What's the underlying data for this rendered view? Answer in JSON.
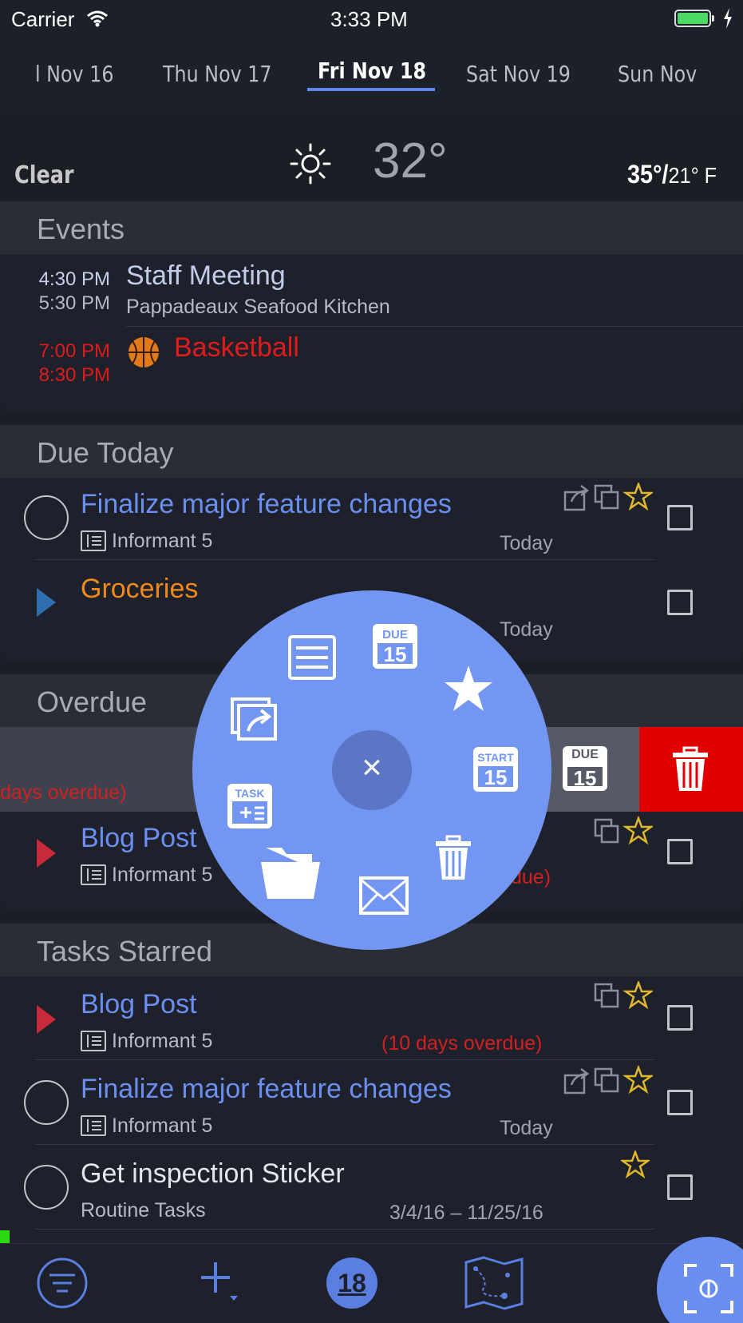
{
  "status_bar": {
    "carrier": "Carrier",
    "time": "3:33 PM"
  },
  "days": [
    {
      "label": "l  Nov 16",
      "selected": false
    },
    {
      "label": "Thu  Nov 17",
      "selected": false
    },
    {
      "label": "Fri  Nov 18",
      "selected": true
    },
    {
      "label": "Sat  Nov 19",
      "selected": false
    },
    {
      "label": "Sun  Nov",
      "selected": false
    }
  ],
  "weather": {
    "condition": "Clear",
    "temp": "32°",
    "high": "35°/",
    "low": "21° F",
    "icon": "sun-icon"
  },
  "events": {
    "header": "Events",
    "items": [
      {
        "start": "4:30 PM",
        "end": "5:30 PM",
        "title": "Staff Meeting",
        "location": "Pappadeaux Seafood Kitchen",
        "color": "#c2cbe8"
      },
      {
        "start": "7:00 PM",
        "end": "8:30 PM",
        "title": "Basketball",
        "location": "",
        "color": "#e01b1b",
        "icon": "basketball-icon"
      }
    ]
  },
  "due_today": {
    "header": "Due Today",
    "items": [
      {
        "title": "Finalize major feature changes",
        "project": "Informant 5",
        "due": "Today"
      },
      {
        "title": "Groceries",
        "project": "",
        "due": "Today"
      }
    ]
  },
  "overdue": {
    "header": "Overdue",
    "swipe_text": "days overdue)",
    "items": [
      {
        "title": "Blog Post",
        "project": "Informant 5",
        "due": "due)"
      }
    ]
  },
  "starred": {
    "header": "Tasks Starred",
    "items": [
      {
        "title": "Blog Post",
        "project": "Informant 5",
        "due": "(10 days overdue)"
      },
      {
        "title": "Finalize major feature changes",
        "project": "Informant 5",
        "due": "Today"
      },
      {
        "title": "Get inspection Sticker",
        "project": "Routine Tasks",
        "due": "3/4/16 – 11/25/16"
      }
    ]
  },
  "radial_menu": {
    "close": "×",
    "badge_due": "DUE",
    "badge_start": "START",
    "badge_task": "TASK",
    "day_num": "15",
    "items": [
      "notes-icon",
      "due-date-icon",
      "star-icon",
      "start-date-icon",
      "trash-icon",
      "mail-icon",
      "folder-icon",
      "new-task-icon",
      "share-icon"
    ]
  },
  "swipe_actions": {
    "due_label": "DUE",
    "due_num": "15"
  },
  "tab_bar": {
    "today_num": "18"
  },
  "colors": {
    "accent": "#6b8ff0",
    "overdue": "#d02020",
    "star": "#e0b82a",
    "groceries": "#f08a1a"
  }
}
